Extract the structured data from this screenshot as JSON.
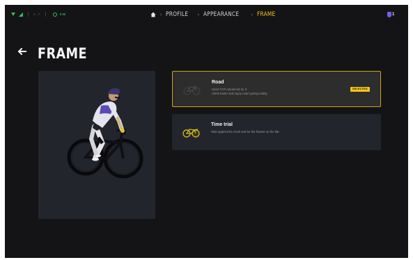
{
  "status": {
    "sensors_text": "≡ ↗",
    "power_text": "0 W"
  },
  "breadcrumb": {
    "items": [
      "PROFILE",
      "APPEARANCE",
      "FRAME"
    ]
  },
  "notifications": {
    "count": "1"
  },
  "page": {
    "title": "FRAME"
  },
  "options": [
    {
      "name": "Road",
      "line1": "Giant TCR Advanced SL 0",
      "line2": "Climb faster and enjoy road cycling reality.",
      "badge": "SELECTED",
      "selected": true
    },
    {
      "name": "Time trial",
      "line1": "Ride against the clock and be the fastest on the flat.",
      "selected": false
    }
  ],
  "colors": {
    "accent": "#f4c21b",
    "background": "#141416",
    "card": "#23252d",
    "status_green": "#2fbf5a",
    "notification_purple": "#7b5de8"
  },
  "icons": {
    "home": "home-icon",
    "back": "arrow-left-icon",
    "notification": "shield-icon",
    "road_thumb": "road-bike-icon",
    "tt_thumb": "time-trial-bike-icon"
  }
}
